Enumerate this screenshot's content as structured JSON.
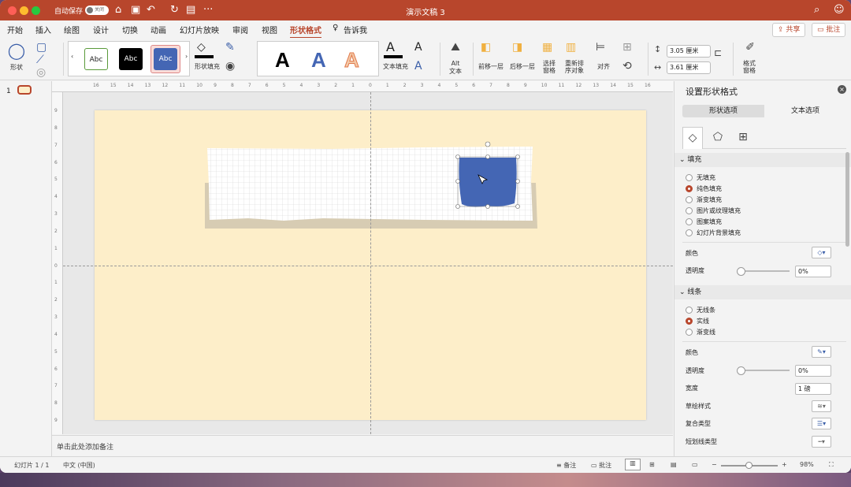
{
  "window": {
    "autosave_label": "自动保存",
    "autosave_state": "关闭",
    "title": "演示文稿 3"
  },
  "tabs": [
    {
      "label": "开始"
    },
    {
      "label": "插入"
    },
    {
      "label": "绘图"
    },
    {
      "label": "设计"
    },
    {
      "label": "切换"
    },
    {
      "label": "动画"
    },
    {
      "label": "幻灯片放映"
    },
    {
      "label": "审阅"
    },
    {
      "label": "视图"
    },
    {
      "label": "形状格式"
    },
    {
      "label": "告诉我"
    }
  ],
  "header": {
    "share_label": "共享",
    "comment_label": "批注"
  },
  "ribbon": {
    "shapes_label": "形状",
    "style_samples": [
      "Abc",
      "Abc",
      "Abc"
    ],
    "shape_fill_label": "形状填充",
    "text_fill_label": "文本填充",
    "wordart": [
      "A",
      "A",
      "A"
    ],
    "alt_text_label": "Alt\n文本",
    "bring_forward_label": "前移一层",
    "send_backward_label": "后移一层",
    "selection_pane_label": "选择\n窗格",
    "reorder_label": "重新排\n序对象",
    "align_label": "对齐",
    "height_value": "3.05 厘米",
    "width_value": "3.61 厘米",
    "format_pane_label": "格式\n窗格"
  },
  "thumbnails": {
    "slide_number": "1"
  },
  "ruler": {
    "h_ticks": [
      "16",
      "15",
      "14",
      "13",
      "12",
      "11",
      "10",
      "9",
      "8",
      "7",
      "6",
      "5",
      "4",
      "3",
      "2",
      "1",
      "0",
      "1",
      "2",
      "3",
      "4",
      "5",
      "6",
      "7",
      "8",
      "9",
      "10",
      "11",
      "12",
      "13",
      "14",
      "15",
      "16"
    ],
    "v_ticks": [
      "9",
      "8",
      "7",
      "6",
      "5",
      "4",
      "3",
      "2",
      "1",
      "0",
      "1",
      "2",
      "3",
      "4",
      "5",
      "6",
      "7",
      "8",
      "9"
    ]
  },
  "notes": {
    "placeholder": "单击此处添加备注"
  },
  "statusbar": {
    "slide_info": "幻灯片 1 / 1",
    "language": "中文 (中国)",
    "notes_label": "备注",
    "comments_label": "批注",
    "zoom": "98%"
  },
  "format_panel": {
    "title": "设置形状格式",
    "tab_shape": "形状选项",
    "tab_text": "文本选项",
    "fill_section": "填充",
    "fill_options": [
      {
        "label": "无填充",
        "selected": false
      },
      {
        "label": "纯色填充",
        "selected": true
      },
      {
        "label": "渐变填充",
        "selected": false
      },
      {
        "label": "图片或纹理填充",
        "selected": false
      },
      {
        "label": "图案填充",
        "selected": false
      },
      {
        "label": "幻灯片背景填充",
        "selected": false
      }
    ],
    "color_label": "颜色",
    "transparency_label": "透明度",
    "fill_transparency": "0%",
    "line_section": "线条",
    "line_options": [
      {
        "label": "无线条",
        "selected": false
      },
      {
        "label": "实线",
        "selected": true
      },
      {
        "label": "渐变线",
        "selected": false
      }
    ],
    "line_color_label": "颜色",
    "line_transparency_label": "透明度",
    "line_transparency": "0%",
    "width_label": "宽度",
    "width_value": "1 磅",
    "sketch_label": "草绘样式",
    "compound_label": "复合类型",
    "dash_label": "短划线类型"
  },
  "colors": {
    "accent": "#b8462c",
    "shape_fill": "#4466b4",
    "slide_bg": "#fdeec9"
  }
}
